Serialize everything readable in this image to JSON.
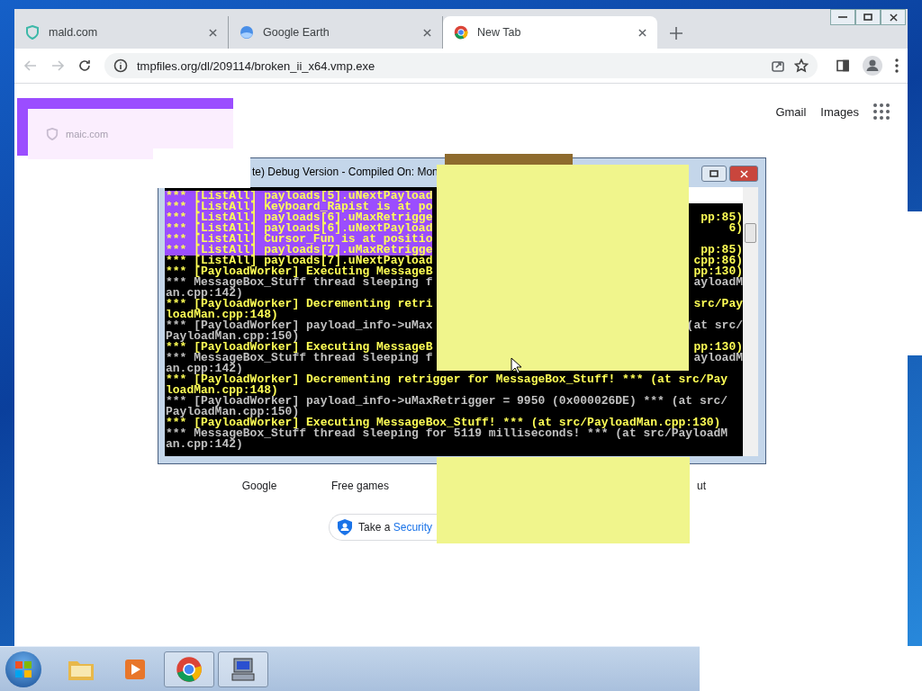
{
  "browser": {
    "tabs": [
      {
        "title": "mald.com",
        "selected": false
      },
      {
        "title": "Google Earth",
        "selected": false
      },
      {
        "title": "New Tab",
        "selected": true
      }
    ],
    "nav": {
      "back_disabled": true,
      "forward_disabled": true
    },
    "address": "tmpfiles.org/dl/209114/broken_ii_x64.vmp.exe",
    "header_links": [
      "Gmail",
      "Images"
    ],
    "shortcuts": [
      "Google",
      "Free games",
      "ut"
    ],
    "security_prompt": {
      "text": "Take a ",
      "link": "Security"
    },
    "glitch_card": {
      "text": "maic.com"
    }
  },
  "console": {
    "title": "te) Debug Version - Compiled On: Mon",
    "lines": [
      {
        "left": "*** [ListAll] payloads[5].uNextPayload",
        "kind": "event",
        "highlighted": true
      },
      {
        "left": "*** [ListAll] Keyboard_Rapist is at po",
        "kind": "event",
        "highlighted": true
      },
      {
        "left": "*** [ListAll] payloads[6].uMaxRetrigge",
        "right": "pp:85)",
        "kind": "event",
        "highlighted": true
      },
      {
        "left": "*** [ListAll] payloads[6].uNextPayload",
        "right": "6)",
        "kind": "event",
        "highlighted": true
      },
      {
        "left": "*** [ListAll] Cursor_Fun is at positio",
        "kind": "event",
        "highlighted": true
      },
      {
        "left": "*** [ListAll] payloads[7].uMaxRetrigge",
        "right": "pp:85)",
        "kind": "event",
        "highlighted": true
      },
      {
        "left": "*** [ListAll] payloads[7].uNextPayload",
        "right": "cpp:86)",
        "kind": "event",
        "highlighted": false
      },
      {
        "left": "*** [PayloadWorker] Executing MessageB",
        "right": "pp:130)",
        "kind": "event",
        "highlighted": false
      },
      {
        "left": "*** MessageBox_Stuff thread sleeping f",
        "right": "ayloadM",
        "kind": "info",
        "highlighted": false
      },
      {
        "left": "an.cpp:142)",
        "kind": "info",
        "highlighted": false
      },
      {
        "left": "*** [PayloadWorker] Decrementing retri",
        "right": "src/Pay",
        "kind": "event",
        "highlighted": false
      },
      {
        "left": "loadMan.cpp:148)",
        "kind": "event",
        "highlighted": false
      },
      {
        "left": "*** [PayloadWorker] payload_info->uMax",
        "right": "(at src/",
        "kind": "info",
        "highlighted": false
      },
      {
        "left": "PayloadMan.cpp:150)",
        "kind": "info",
        "highlighted": false
      },
      {
        "left": "*** [PayloadWorker] Executing MessageB",
        "right": "pp:130)",
        "kind": "event",
        "highlighted": false
      },
      {
        "left": "*** MessageBox_Stuff thread sleeping f",
        "right": "ayloadM",
        "kind": "info",
        "highlighted": false
      },
      {
        "left": "an.cpp:142)",
        "kind": "info",
        "highlighted": false
      },
      {
        "left": "*** [PayloadWorker] Decrementing retrigger for MessageBox_Stuff! *** (at src/Pay",
        "kind": "event",
        "highlighted": false
      },
      {
        "left": "loadMan.cpp:148)",
        "kind": "event",
        "highlighted": false
      },
      {
        "left": "*** [PayloadWorker] payload_info->uMaxRetrigger = 9950 (0x000026DE) *** (at src/",
        "kind": "info",
        "highlighted": false
      },
      {
        "left": "PayloadMan.cpp:150)",
        "kind": "info",
        "highlighted": false
      },
      {
        "left": "*** [PayloadWorker] Executing MessageBox_Stuff! *** (at src/PayloadMan.cpp:130)",
        "kind": "event",
        "highlighted": false
      },
      {
        "left": "*** MessageBox_Stuff thread sleeping for 5119 milliseconds! *** (at src/PayloadM",
        "kind": "info",
        "highlighted": false
      },
      {
        "left": "an.cpp:142)",
        "kind": "info",
        "highlighted": false
      }
    ]
  },
  "taskbar": {
    "items": [
      {
        "active": false
      },
      {
        "active": false
      },
      {
        "active": true
      },
      {
        "active": true
      }
    ]
  }
}
